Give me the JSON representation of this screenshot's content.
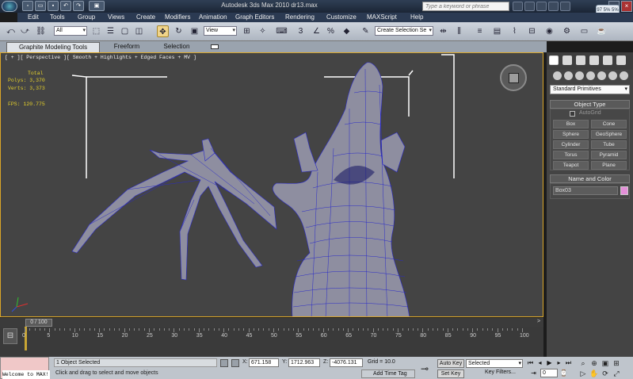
{
  "window": {
    "title": "Autodesk 3ds Max  2010      dr13.max",
    "search_placeholder": "Type a keyword or phrase",
    "clock": "97 5% 5%"
  },
  "menu": [
    "Edit",
    "Tools",
    "Group",
    "Views",
    "Create",
    "Modifiers",
    "Animation",
    "Graph Editors",
    "Rendering",
    "Customize",
    "MAXScript",
    "Help"
  ],
  "toolbar": {
    "filter": "All",
    "ref_coord": "View",
    "named_selection": "Create Selection Se"
  },
  "ribbon": {
    "tabs": [
      "Graphite Modeling Tools",
      "Freeform",
      "Selection"
    ]
  },
  "viewport": {
    "label": "[ + ][ Perspective ][ Smooth + Highlights + Edged Faces + MV ]",
    "stats": {
      "total": "Total",
      "polys": "Polys: 3,370",
      "verts": "Verts: 3,373",
      "fps": "FPS:    120.775"
    }
  },
  "command_panel": {
    "category": "Standard Primitives",
    "object_type_title": "Object Type",
    "autogrid": "AutoGrid",
    "buttons": [
      "Box",
      "Cone",
      "Sphere",
      "GeoSphere",
      "Cylinder",
      "Tube",
      "Torus",
      "Pyramid",
      "Teapot",
      "Plane"
    ],
    "name_color_title": "Name and Color",
    "object_name": "Box03",
    "colors": {
      "object_color": "#e38fd8",
      "viewport_bg": "#444444",
      "mesh_fill": "#8e8ea0",
      "wire": "#2222c0"
    }
  },
  "timeline": {
    "frame": "0 / 100",
    "ticks": [
      "0",
      "5",
      "10",
      "15",
      "20",
      "25",
      "30",
      "35",
      "40",
      "45",
      "50",
      "55",
      "60",
      "65",
      "70",
      "75",
      "80",
      "85",
      "90",
      "95",
      "100"
    ]
  },
  "status": {
    "listener": "Welcome to MAX!",
    "selection": "1 Object Selected",
    "prompt": "Click and drag to select and move objects",
    "x_label": "X:",
    "x": "671.158",
    "y_label": "Y:",
    "y": "1712.963",
    "z_label": "Z:",
    "z": "-4076.131",
    "grid": "Grid = 10.0",
    "add_time_tag": "Add Time Tag",
    "auto_key": "Auto Key",
    "set_key": "Set Key",
    "selected": "Selected",
    "key_filters": "Key Filters...",
    "frame_field": "0"
  }
}
